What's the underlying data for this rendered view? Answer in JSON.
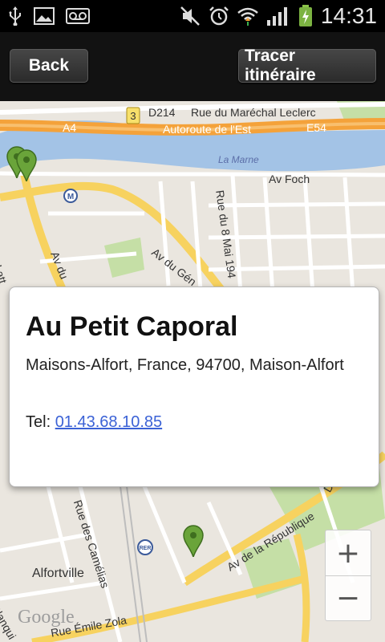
{
  "status_bar": {
    "icons": [
      "usb-icon",
      "image-icon",
      "voicemail-icon",
      "mute-icon",
      "alarm-icon",
      "wifi-icon",
      "signal-icon",
      "battery-charging-icon"
    ],
    "time": "14:31"
  },
  "toolbar": {
    "back_label": "Back",
    "route_label": "Tracer itinéraire"
  },
  "map": {
    "labels": {
      "d214": "D214",
      "rue_marechal": "Rue du Maréchal Leclerc",
      "a4": "A4",
      "autoroute": "Autoroute de l'Est",
      "e54": "E54",
      "la_marne": "La Marne",
      "av_foch": "Av Foch",
      "rue_8_mai": "Rue du 8 Mai 194",
      "av_du_gen": "Av du Gén",
      "av_du": "Av du",
      "lattre": "in Latt",
      "rue_camelias": "Rue des Camélias",
      "av_republique": "Av de la République",
      "alfortville": "Alfortville",
      "rue_emile_zola": "Rue Émile Zola",
      "blanqui": "Blanqui",
      "d_label": "D",
      "road_shield": "3",
      "metro": "M",
      "rer": "RER"
    },
    "google": "Google"
  },
  "popup": {
    "title": "Au Petit Caporal",
    "address": "Maisons-Alfort, France, 94700, Maison-Alfort",
    "tel_label": "Tel:",
    "tel_number": "01.43.68.10.85"
  },
  "zoom": {
    "in_label": "+",
    "out_label": "−"
  },
  "colors": {
    "highway": "#f4a23a",
    "road_major": "#f7d25f",
    "river": "#a3c3e6",
    "park": "#c5dfa6",
    "pin": "#6aa43a"
  }
}
